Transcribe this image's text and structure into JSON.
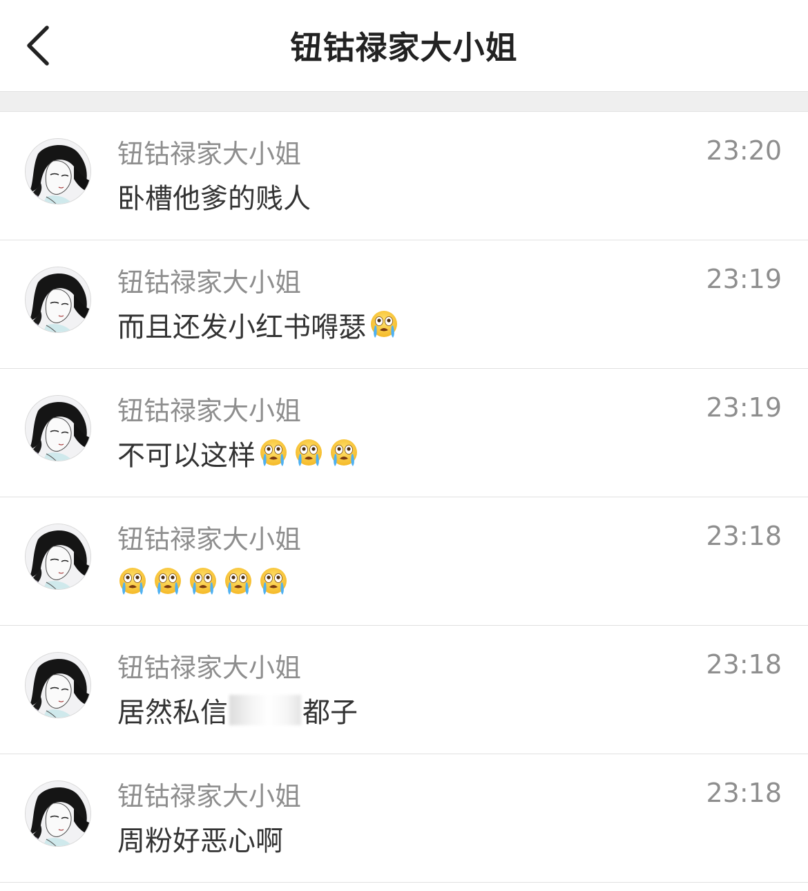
{
  "header": {
    "title": "钮钴禄家大小姐",
    "back_icon": "chevron-left-icon"
  },
  "messages": [
    {
      "sender": "钮钴禄家大小姐",
      "time": "23:20",
      "text": "卧槽他爹的贱人",
      "emoji": [],
      "redacted": false
    },
    {
      "sender": "钮钴禄家大小姐",
      "time": "23:19",
      "text": "而且还发小红书嘚瑟",
      "emoji": [
        "loudly-crying-face-icon"
      ],
      "redacted": false
    },
    {
      "sender": "钮钴禄家大小姐",
      "time": "23:19",
      "text": "不可以这样",
      "emoji": [
        "loudly-crying-face-icon",
        "loudly-crying-face-icon",
        "loudly-crying-face-icon"
      ],
      "redacted": false
    },
    {
      "sender": "钮钴禄家大小姐",
      "time": "23:18",
      "text": "",
      "emoji": [
        "loudly-crying-face-icon",
        "loudly-crying-face-icon",
        "loudly-crying-face-icon",
        "loudly-crying-face-icon",
        "loudly-crying-face-icon"
      ],
      "redacted": false
    },
    {
      "sender": "钮钴禄家大小姐",
      "time": "23:18",
      "text": "居然私信",
      "text_after": "都子",
      "emoji": [],
      "redacted": true
    },
    {
      "sender": "钮钴禄家大小姐",
      "time": "23:18",
      "text": "周粉好恶心啊",
      "emoji": [],
      "redacted": false
    }
  ],
  "colors": {
    "title": "#222222",
    "meta": "#8e8e8e",
    "message": "#333333",
    "divider": "#e0e0e0",
    "gap": "#efefef"
  }
}
